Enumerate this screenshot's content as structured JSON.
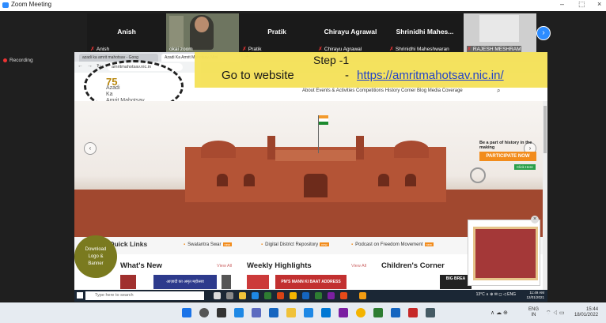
{
  "window": {
    "title": "Zoom Meeting",
    "minimize": "–",
    "maximize": "⬚",
    "close": "×"
  },
  "participants": [
    {
      "name": "Anish",
      "label": "Anish"
    },
    {
      "name": "",
      "label": "okai zoom"
    },
    {
      "name": "Pratik",
      "label": "Pratik"
    },
    {
      "name": "Chirayu Agrawal",
      "label": "Chirayu Agrawal"
    },
    {
      "name": "Shrinidhi Mahes...",
      "label": "Shrinidhi Maheshwaran"
    },
    {
      "name": "",
      "label": "RAJESH MESHRAM"
    }
  ],
  "recording": "Recording",
  "browser": {
    "tabs": [
      "azadi ka amrit mahotsav - Goog",
      "Azadi Ka Amrit Mahotsav, Mini"
    ],
    "new_tab": "+",
    "url": "amritmahotsav.nic.in"
  },
  "overlay": {
    "step": "Step -1",
    "goto": "Go to website",
    "dash": "-",
    "link": "https://amritmahotsav.nic.in/"
  },
  "site": {
    "logo_line1": "75",
    "logo_line2": "Azadi",
    "logo_line3": "Ka",
    "logo_line4": "Amrit Mahotsav",
    "nav": "About  Events & Activities  Competitions  History Corner  Blog  Media Coverage",
    "promo_text": "Be a part of history in the making",
    "participate": "PARTICIPATE NOW",
    "click_here": "Click Here",
    "quick_links": "Quick Links",
    "ql_items": [
      "Swatantra Swar",
      "Digital District Repository",
      "Podcast on Freedom Movement"
    ],
    "new_badge": "new",
    "download": [
      "Download",
      "Logo &",
      "Banner"
    ],
    "whats_new": "What's New",
    "weekly": "Weekly Highlights",
    "childrens": "Children's Corner",
    "view_all": "View All",
    "mann_ki_baat": "PM'S MANN KI BAAT ADDRESS",
    "hindi_banner": "आज़ादी का अमृत महोत्सव",
    "big_bre": "BIG BREA"
  },
  "inner_taskbar": {
    "search": "Type here to search",
    "tray": "13°C  ∧  ⊕  ✉  ◻  ◁  ENG",
    "time": "11:49 AM",
    "date": "12/01/2021"
  },
  "taskbar": {
    "tray": "∧  ☁  ⊕",
    "lang": [
      "ENG",
      "IN"
    ],
    "time": "15:44",
    "date": "18/01/2022"
  }
}
